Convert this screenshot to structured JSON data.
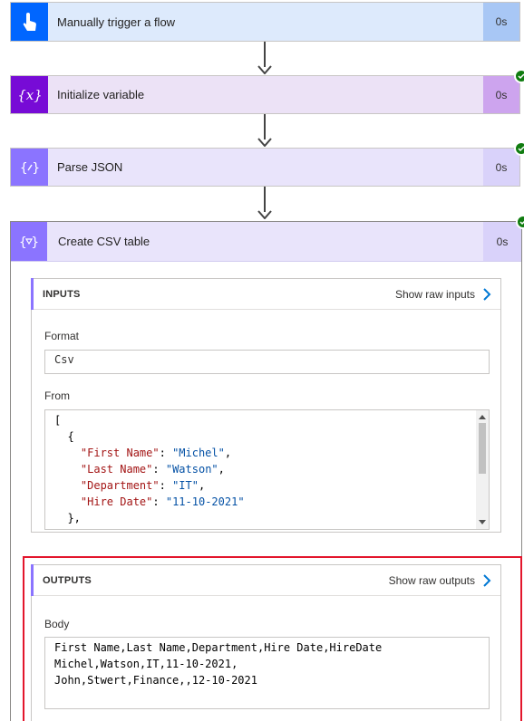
{
  "steps": [
    {
      "title": "Manually trigger a flow",
      "duration": "0s",
      "icon": "touch-icon",
      "header_bg": "#ddeafc",
      "icon_bg": "#0066ff",
      "dur_bg": "#a8c7f5"
    },
    {
      "title": "Initialize variable",
      "duration": "0s",
      "icon": "variable-icon",
      "header_bg": "#ece2f6",
      "icon_bg": "#770bd6",
      "dur_bg": "#cda4ee"
    },
    {
      "title": "Parse JSON",
      "duration": "0s",
      "icon": "json-icon",
      "header_bg": "#e9e4fb",
      "icon_bg": "#8b74ff",
      "dur_bg": "#d9d2fa"
    }
  ],
  "csv_step": {
    "title": "Create CSV table",
    "duration": "0s",
    "icon": "table-icon",
    "inputs": {
      "header": "INPUTS",
      "raw_link": "Show raw inputs",
      "format_label": "Format",
      "format_value": "Csv",
      "from_label": "From",
      "from_lines": [
        "[",
        "  {",
        "    \"First Name\": \"Michel\",",
        "    \"Last Name\": \"Watson\",",
        "    \"Department\": \"IT\",",
        "    \"Hire Date\": \"11-10-2021\"",
        "  },",
        "  {"
      ]
    },
    "outputs": {
      "header": "OUTPUTS",
      "raw_link": "Show raw outputs",
      "body_label": "Body",
      "body_lines": [
        "First Name,Last Name,Department,Hire Date,HireDate",
        "Michel,Watson,IT,11-10-2021,",
        "John,Stwert,Finance,,12-10-2021"
      ]
    }
  },
  "colors": {
    "success": "#107c10",
    "accent": "#8b74ff",
    "highlight": "#e3162c",
    "link": "#0078d4"
  }
}
